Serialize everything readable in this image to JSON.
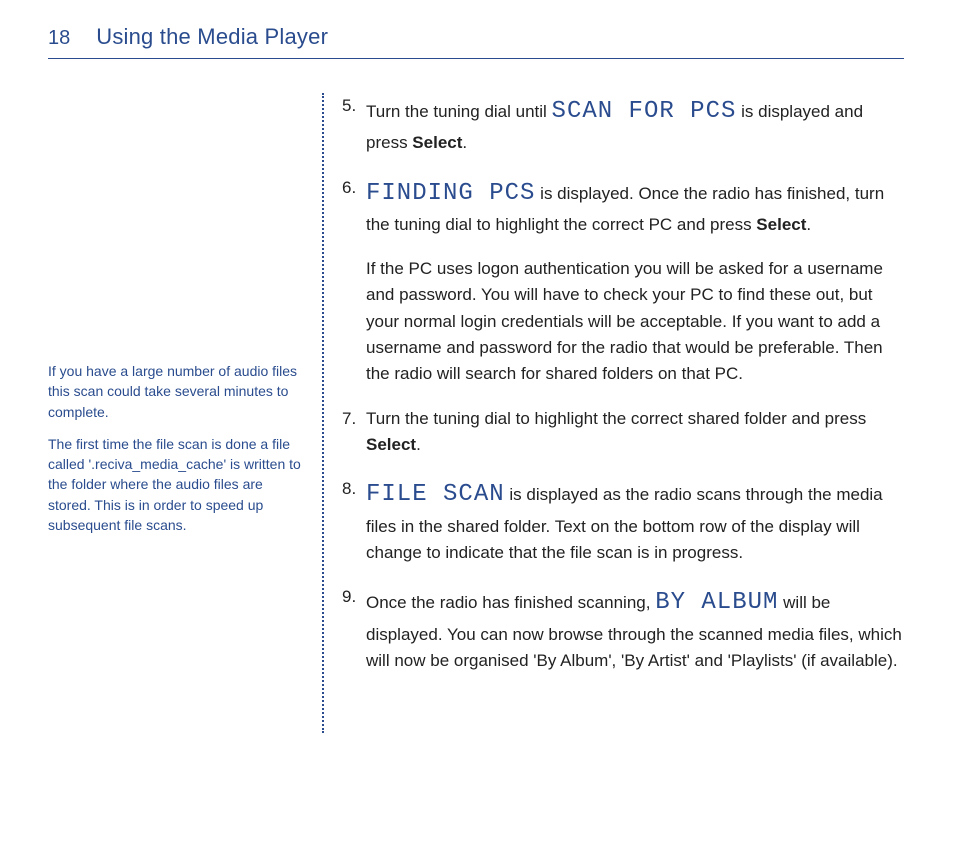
{
  "header": {
    "page_number": "18",
    "title": "Using the Media Player"
  },
  "sidebar": {
    "note1": "If you have a large number of audio files this scan could take several minutes to complete.",
    "note2": "The first time the file scan is done a file called '.reciva_media_cache' is written to the folder where the audio files are stored. This is in order to speed up subsequent file scans."
  },
  "steps": {
    "s5": {
      "num": "5.",
      "pre": "Turn the tuning dial until ",
      "lcd": "SCAN FOR PCS",
      "post": " is displayed and press ",
      "bold": "Select",
      "end": "."
    },
    "s6": {
      "num": "6.",
      "lcd": "FINDING PCS",
      "mid": " is displayed. Once the radio has finished, turn the tuning dial to highlight the correct PC and press ",
      "bold": "Select",
      "end": "."
    },
    "indent6": "If the PC uses logon authentication you will be asked for a username and password. You will have to check your PC to find these out, but your normal login credentials will be acceptable. If you want to add a username and password for the radio that would be preferable. Then the radio will search for shared folders on that PC.",
    "s7": {
      "num": "7.",
      "pre": "Turn the tuning dial to highlight the correct shared folder and press ",
      "bold": "Select",
      "end": "."
    },
    "s8": {
      "num": "8.",
      "lcd": "FILE SCAN",
      "post": " is displayed as the radio scans through the media files in the shared folder. Text on the bottom row of the display will change to indicate that the file scan is in progress."
    },
    "s9": {
      "num": "9.",
      "pre": "Once the radio has finished scanning, ",
      "lcd": "BY ALBUM",
      "post": " will be displayed. You can now browse through the scanned media files, which will now be organised 'By Album', 'By Artist' and 'Playlists' (if available)."
    }
  }
}
